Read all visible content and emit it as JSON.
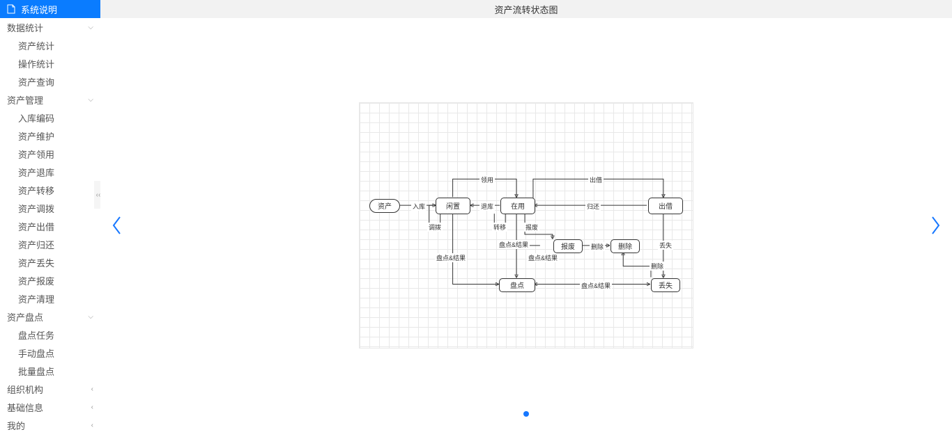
{
  "sidebar": {
    "active_item": "系统说明",
    "groups": [
      {
        "label": "数据统计",
        "expanded": true,
        "children": [
          "资产统计",
          "操作统计",
          "资产查询"
        ]
      },
      {
        "label": "资产管理",
        "expanded": true,
        "children": [
          "入库编码",
          "资产维护",
          "资产领用",
          "资产退库",
          "资产转移",
          "资产调拨",
          "资产出借",
          "资产归还",
          "资产丢失",
          "资产报废",
          "资产清理"
        ]
      },
      {
        "label": "资产盘点",
        "expanded": true,
        "children": [
          "盘点任务",
          "手动盘点",
          "批量盘点"
        ]
      },
      {
        "label": "组织机构",
        "expanded": false
      },
      {
        "label": "基础信息",
        "expanded": false
      },
      {
        "label": "我的",
        "expanded": false
      }
    ]
  },
  "page_title": "资产流转状态图",
  "diagram": {
    "nodes": {
      "asset": "资产",
      "idle": "闲置",
      "inuse": "在用",
      "lend": "出借",
      "scrap1": "报废",
      "scrap2": "删除",
      "lost": "丢失",
      "check": "盘点"
    },
    "edges": {
      "in": "入库",
      "use": "领用",
      "back": "退库",
      "lend_out": "出借",
      "return": "归还",
      "transfer": "调拨",
      "move": "转移",
      "scrap": "报废",
      "delete": "删除",
      "lost": "丢失",
      "del2": "删除",
      "chk_res1": "盘点&结果",
      "chk_res2": "盘点&结果",
      "chk_res3": "盘点&结果",
      "chk_res4": "盘点&结果"
    }
  }
}
